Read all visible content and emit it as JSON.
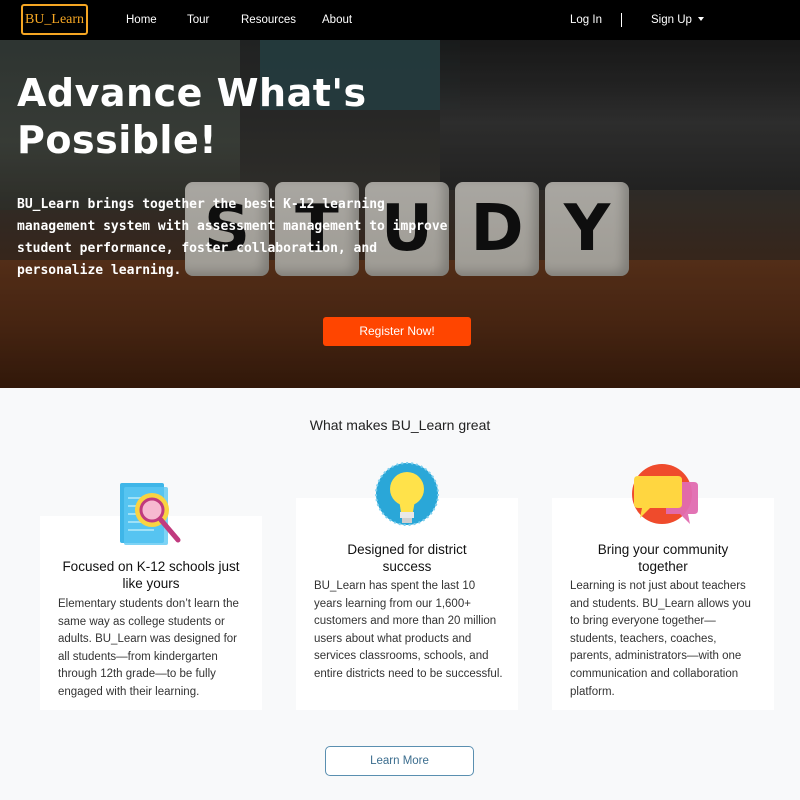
{
  "nav": {
    "brand": "BU_Learn",
    "links": [
      "Home",
      "Tour",
      "Resources",
      "About"
    ],
    "login": "Log In",
    "signup": "Sign Up"
  },
  "hero": {
    "title": "Advance What's Possible!",
    "text": "BU_Learn brings together the best K-12 learning management system with assessment management to improve student performance, foster collaboration, and personalize learning.",
    "button": "Register Now!",
    "dice_letters": [
      "S",
      "T",
      "U",
      "D",
      "Y"
    ]
  },
  "features": {
    "title": "What makes BU_Learn great",
    "cards": [
      {
        "icon": "document-magnifier-icon",
        "title": "Focused on K-12 schools just like yours",
        "body": "Elementary students don’t learn the same way as college students or adults. BU_Learn was designed for all students—from kindergarten through 12th grade—to be fully engaged with their learning."
      },
      {
        "icon": "lightbulb-icon",
        "title": "Designed for district success",
        "body": "BU_Learn has spent the last 10 years learning from our 1,600+ customers and more than 20 million users about what products and services classrooms, schools, and entire districts need to be successful."
      },
      {
        "icon": "chat-bubbles-icon",
        "title": "Bring your community together",
        "body": "Learning is not just about teachers and students. BU_Learn allows you to bring everyone together—students, teachers, coaches, parents, administrators—with one communication and collaboration platform."
      }
    ],
    "button": "Learn More"
  },
  "colors": {
    "accent": "#ff4500",
    "brand": "#f5a623",
    "navbar": "#000000"
  }
}
